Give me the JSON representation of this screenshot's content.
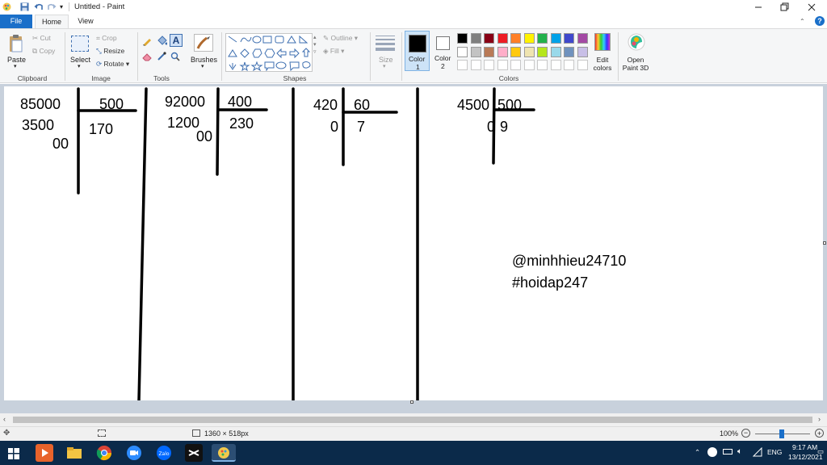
{
  "title_bar": {
    "title": "Untitled - Paint"
  },
  "tabs": {
    "file": "File",
    "home": "Home",
    "view": "View"
  },
  "clipboard": {
    "paste": "Paste",
    "cut": "Cut",
    "copy": "Copy",
    "group": "Clipboard"
  },
  "image": {
    "select": "Select",
    "crop": "Crop",
    "resize": "Resize",
    "rotate": "Rotate",
    "group": "Image"
  },
  "tools": {
    "group": "Tools"
  },
  "brushes": {
    "label": "Brushes"
  },
  "shapes": {
    "outline": "Outline",
    "fill": "Fill",
    "group": "Shapes"
  },
  "size": {
    "label": "Size"
  },
  "colors": {
    "color1": "Color",
    "color1_num": "1",
    "color2": "Color",
    "color2_num": "2",
    "edit_colors": "Edit colors",
    "group": "Colors",
    "color1_value": "#000000",
    "color2_value": "#ffffff",
    "palette_row1": [
      "#000000",
      "#7f7f7f",
      "#880015",
      "#ed1c24",
      "#ff7f27",
      "#fff200",
      "#22b14c",
      "#00a2e8",
      "#3f48cc",
      "#a349a4"
    ],
    "palette_row2": [
      "#ffffff",
      "#c3c3c3",
      "#b97a57",
      "#ffaec9",
      "#ffc90e",
      "#efe4b0",
      "#b5e61d",
      "#99d9ea",
      "#7092be",
      "#c8bfe7"
    ]
  },
  "paint3d": {
    "label": "Open Paint 3D"
  },
  "canvas": {
    "div1": {
      "dividend": "85000",
      "divisor": "500",
      "step1": "3500",
      "remainder": "00",
      "quotient": "170"
    },
    "div2": {
      "dividend": "92000",
      "divisor": "400",
      "step1": "1200",
      "remainder": "00",
      "quotient": "230"
    },
    "div3": {
      "dividend": "420",
      "divisor": "60",
      "remainder": "0",
      "quotient": "7"
    },
    "div4": {
      "dividend": "4500",
      "divisor": "500",
      "remainder": "0",
      "quotient": "9"
    },
    "signature_line1": "@minhhieu24710",
    "signature_line2": "#hoidap247"
  },
  "status": {
    "canvas_size": "1360 × 518px",
    "zoom": "100%"
  },
  "taskbar": {
    "language": "ENG",
    "time": "9:17 AM",
    "date": "13/12/2021"
  }
}
